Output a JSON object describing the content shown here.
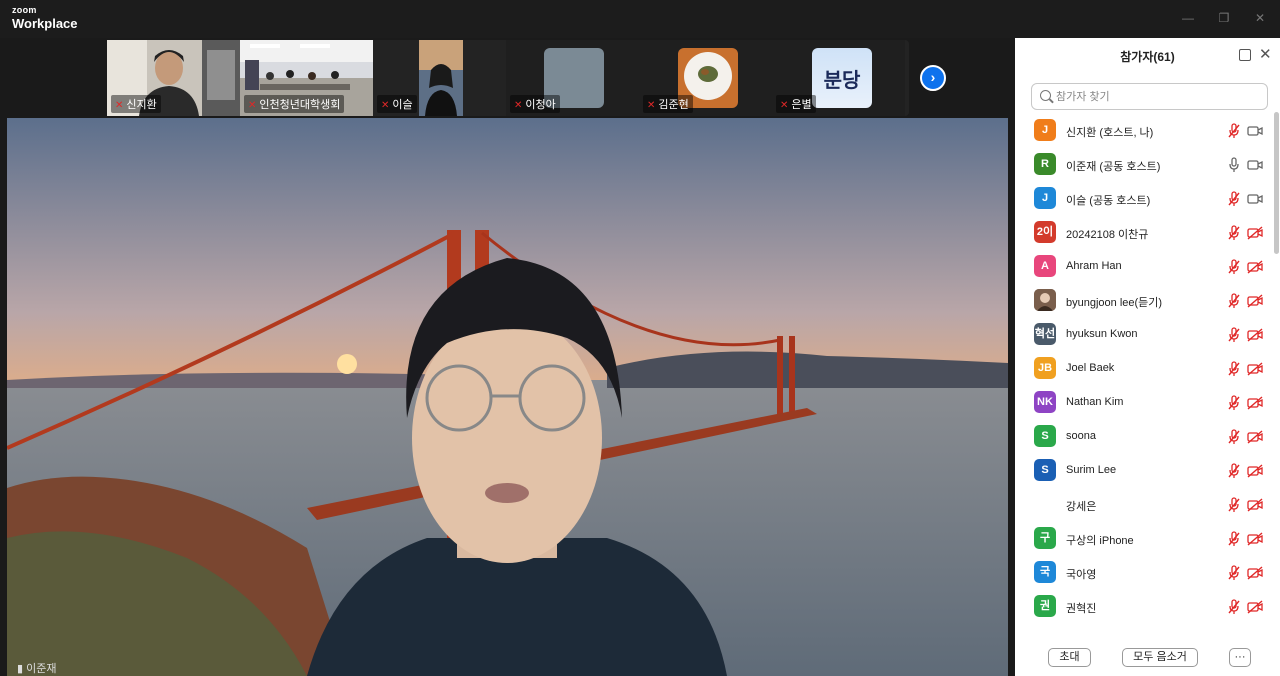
{
  "app": {
    "brand_small": "zoom",
    "brand_big": "Workplace"
  },
  "window_controls": {
    "minimize": "—",
    "restore": "❐",
    "close": "✕"
  },
  "gallery": {
    "tiles": [
      {
        "name": "신지환",
        "muted": true
      },
      {
        "name": "인천청년대학생회",
        "muted": true
      },
      {
        "name": "이슬",
        "muted": true
      },
      {
        "name": "이청아",
        "muted": true
      },
      {
        "name": "김준현",
        "muted": true
      },
      {
        "name": "은별",
        "muted": true
      }
    ],
    "avatar_text_bundang": "분당",
    "next_label": "›"
  },
  "main": {
    "speaker_name": "이준재"
  },
  "panel": {
    "title": "참가자(61)",
    "search_placeholder": "참가자 찾기",
    "participants": [
      {
        "initial": "J",
        "name": "신지환 (호스트, 나)",
        "color": "#f07d1a",
        "mic": "muted",
        "cam": "on"
      },
      {
        "initial": "R",
        "name": "이준재 (공동 호스트)",
        "color": "#3a8a2a",
        "mic": "on",
        "cam": "on"
      },
      {
        "initial": "J",
        "name": "이슬 (공동 호스트)",
        "color": "#1e88d8",
        "mic": "muted",
        "cam": "on"
      },
      {
        "initial": "2이",
        "name": "20242108 이찬규",
        "color": "#d33b2c",
        "mic": "muted",
        "cam": "off"
      },
      {
        "initial": "A",
        "name": "Ahram Han",
        "color": "#e8467c",
        "mic": "muted",
        "cam": "off"
      },
      {
        "initial": "",
        "name": "byungjoon lee(듣기)",
        "color": "#8a6b55",
        "mic": "muted",
        "cam": "off"
      },
      {
        "initial": "혁선",
        "name": "hyuksun Kwon",
        "color": "#4a5a6a",
        "mic": "muted",
        "cam": "off"
      },
      {
        "initial": "JB",
        "name": "Joel Baek",
        "color": "#f0a020",
        "mic": "muted",
        "cam": "off"
      },
      {
        "initial": "NK",
        "name": "Nathan Kim",
        "color": "#8e44c4",
        "mic": "muted",
        "cam": "off"
      },
      {
        "initial": "S",
        "name": "soona",
        "color": "#2aa84a",
        "mic": "muted",
        "cam": "off"
      },
      {
        "initial": "S",
        "name": "Surim Lee",
        "color": "#1a5fb4",
        "mic": "muted",
        "cam": "off"
      },
      {
        "initial": "",
        "name": "강세은",
        "color": "#ffffff",
        "mic": "muted",
        "cam": "off"
      },
      {
        "initial": "구",
        "name": "구상의 iPhone",
        "color": "#2aa84a",
        "mic": "muted",
        "cam": "off"
      },
      {
        "initial": "국",
        "name": "국아영",
        "color": "#1e88d8",
        "mic": "muted",
        "cam": "off"
      },
      {
        "initial": "권",
        "name": "권혁진",
        "color": "#2aa84a",
        "mic": "muted",
        "cam": "off"
      }
    ],
    "invite_label": "초대",
    "mute_all_label": "모두 음소거",
    "more_label": "···"
  },
  "colors": {
    "accent": "#0e72ed",
    "muted_red": "#e02828"
  }
}
